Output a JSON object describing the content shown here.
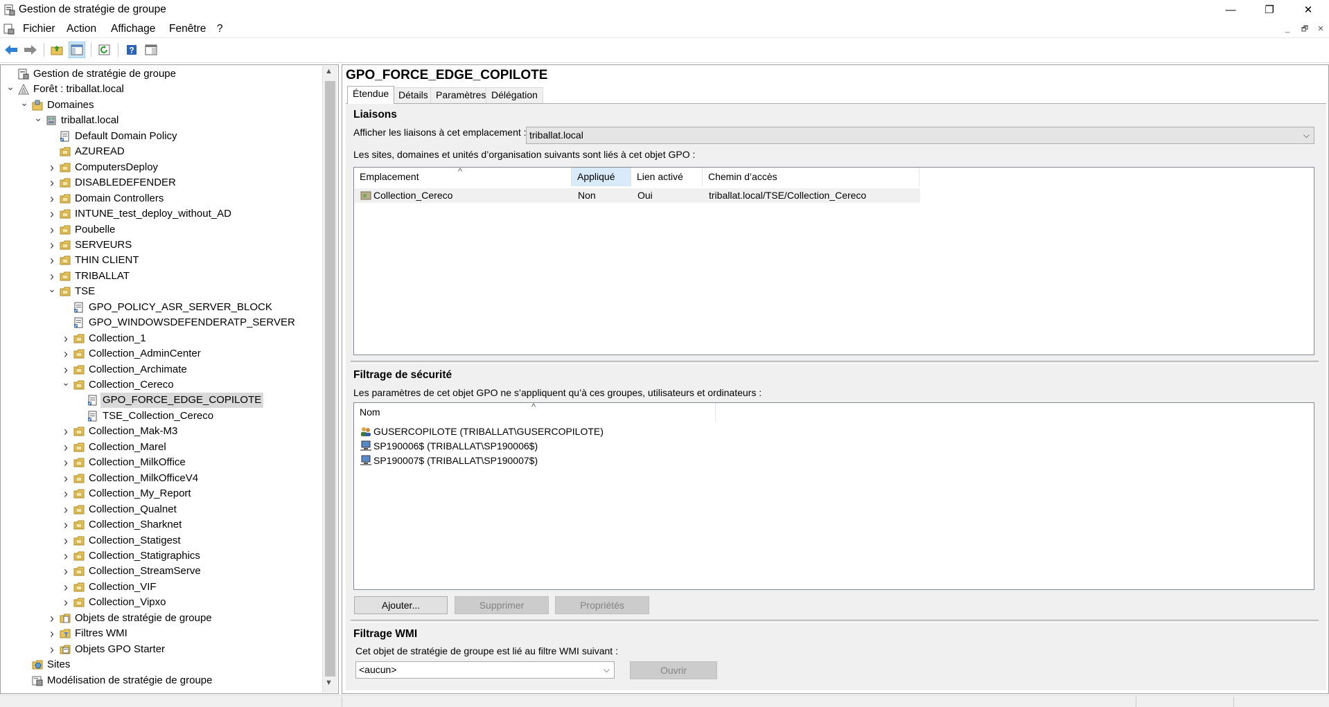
{
  "window": {
    "title": "Gestion de stratégie de groupe",
    "controls": {
      "minimize": "—",
      "restore": "❐",
      "close": "✕"
    }
  },
  "menu": [
    "Fichier",
    "Action",
    "Affichage",
    "Fenêtre",
    "?"
  ],
  "toolbar_icons": [
    "back-arrow-icon",
    "forward-arrow-icon",
    "up-folder-icon",
    "show-hide-tree-icon",
    "refresh-icon",
    "help-icon",
    "console-pane-icon"
  ],
  "tree": {
    "items": [
      {
        "label": "Gestion de stratégie de groupe",
        "icon": "gpmc-root-icon",
        "level": 0,
        "expander": ""
      },
      {
        "label": "Forêt : triballat.local",
        "icon": "forest-icon",
        "level": 0,
        "expander": "v"
      },
      {
        "label": "Domaines",
        "icon": "domains-folder-icon",
        "level": 1,
        "expander": "v"
      },
      {
        "label": "triballat.local",
        "icon": "domain-icon",
        "level": 2,
        "expander": "v"
      },
      {
        "label": "Default Domain Policy",
        "icon": "gpo-link-icon",
        "level": 3,
        "expander": ""
      },
      {
        "label": "AZUREAD",
        "icon": "ou-folder-icon",
        "level": 3,
        "expander": ""
      },
      {
        "label": "ComputersDeploy",
        "icon": "ou-folder-icon",
        "level": 3,
        "expander": ">"
      },
      {
        "label": "DISABLEDEFENDER",
        "icon": "ou-folder-icon",
        "level": 3,
        "expander": ">"
      },
      {
        "label": "Domain Controllers",
        "icon": "ou-folder-icon",
        "level": 3,
        "expander": ">"
      },
      {
        "label": "INTUNE_test_deploy_without_AD",
        "icon": "ou-folder-icon",
        "level": 3,
        "expander": ">"
      },
      {
        "label": "Poubelle",
        "icon": "ou-folder-icon",
        "level": 3,
        "expander": ">"
      },
      {
        "label": "SERVEURS",
        "icon": "ou-folder-icon",
        "level": 3,
        "expander": ">"
      },
      {
        "label": "THIN CLIENT",
        "icon": "ou-folder-icon",
        "level": 3,
        "expander": ">"
      },
      {
        "label": "TRIBALLAT",
        "icon": "ou-folder-icon",
        "level": 3,
        "expander": ">"
      },
      {
        "label": "TSE",
        "icon": "ou-folder-icon",
        "level": 3,
        "expander": "v"
      },
      {
        "label": "GPO_POLICY_ASR_SERVER_BLOCK",
        "icon": "gpo-link-icon",
        "level": 4,
        "expander": ""
      },
      {
        "label": "GPO_WINDOWSDEFENDERATP_SERVER",
        "icon": "gpo-link-icon",
        "level": 4,
        "expander": ""
      },
      {
        "label": "Collection_1",
        "icon": "ou-folder-icon",
        "level": 4,
        "expander": ">"
      },
      {
        "label": "Collection_AdminCenter",
        "icon": "ou-folder-icon",
        "level": 4,
        "expander": ">"
      },
      {
        "label": "Collection_Archimate",
        "icon": "ou-folder-icon",
        "level": 4,
        "expander": ">"
      },
      {
        "label": "Collection_Cereco",
        "icon": "ou-folder-icon",
        "level": 4,
        "expander": "v"
      },
      {
        "label": "GPO_FORCE_EDGE_COPILOTE",
        "icon": "gpo-link-icon",
        "level": 5,
        "expander": "",
        "selected": true
      },
      {
        "label": "TSE_Collection_Cereco",
        "icon": "gpo-link-icon",
        "level": 5,
        "expander": ""
      },
      {
        "label": "Collection_Mak-M3",
        "icon": "ou-folder-icon",
        "level": 4,
        "expander": ">"
      },
      {
        "label": "Collection_Marel",
        "icon": "ou-folder-icon",
        "level": 4,
        "expander": ">"
      },
      {
        "label": "Collection_MilkOffice",
        "icon": "ou-folder-icon",
        "level": 4,
        "expander": ">"
      },
      {
        "label": "Collection_MilkOfficeV4",
        "icon": "ou-folder-icon",
        "level": 4,
        "expander": ">"
      },
      {
        "label": "Collection_My_Report",
        "icon": "ou-folder-icon",
        "level": 4,
        "expander": ">"
      },
      {
        "label": "Collection_Qualnet",
        "icon": "ou-folder-icon",
        "level": 4,
        "expander": ">"
      },
      {
        "label": "Collection_Sharknet",
        "icon": "ou-folder-icon",
        "level": 4,
        "expander": ">"
      },
      {
        "label": "Collection_Statigest",
        "icon": "ou-folder-icon",
        "level": 4,
        "expander": ">"
      },
      {
        "label": "Collection_Statigraphics",
        "icon": "ou-folder-icon",
        "level": 4,
        "expander": ">"
      },
      {
        "label": "Collection_StreamServe",
        "icon": "ou-folder-icon",
        "level": 4,
        "expander": ">"
      },
      {
        "label": "Collection_VIF",
        "icon": "ou-folder-icon",
        "level": 4,
        "expander": ">"
      },
      {
        "label": "Collection_Vipxo",
        "icon": "ou-folder-icon",
        "level": 4,
        "expander": ">"
      },
      {
        "label": "Objets de stratégie de groupe",
        "icon": "gpo-container-icon",
        "level": 3,
        "expander": ">"
      },
      {
        "label": "Filtres WMI",
        "icon": "wmi-folder-icon",
        "level": 3,
        "expander": ">"
      },
      {
        "label": "Objets GPO Starter",
        "icon": "starter-gpo-icon",
        "level": 3,
        "expander": ">"
      },
      {
        "label": "Sites",
        "icon": "sites-icon",
        "level": 1,
        "expander": ""
      },
      {
        "label": "Modélisation de stratégie de groupe",
        "icon": "modeling-icon",
        "level": 1,
        "expander": ""
      }
    ]
  },
  "gpo": {
    "title": "GPO_FORCE_EDGE_COPILOTE",
    "tabs": [
      {
        "label": "Étendue",
        "active": true
      },
      {
        "label": "Détails"
      },
      {
        "label": "Paramètres"
      },
      {
        "label": "Délégation"
      }
    ]
  },
  "links": {
    "section_title": "Liaisons",
    "location_label": "Afficher les liaisons à cet emplacement :",
    "location_value": "triballat.local",
    "description": "Les sites, domaines et unités d’organisation suivants sont liés à cet objet GPO :",
    "columns": [
      "Emplacement",
      "Appliqué",
      "Lien activé",
      "Chemin d’accès"
    ],
    "rows": [
      {
        "location": "Collection_Cereco",
        "enforced": "Non",
        "enabled": "Oui",
        "path": "triballat.local/TSE/Collection_Cereco"
      }
    ]
  },
  "security": {
    "section_title": "Filtrage de sécurité",
    "description": "Les paramètres de cet objet GPO ne s’appliquent qu’à ces groupes, utilisateurs et ordinateurs :",
    "column": "Nom",
    "rows": [
      {
        "name": "GUSERCOPILOTE (TRIBALLAT\\GUSERCOPILOTE)",
        "icon": "group-icon"
      },
      {
        "name": "SP190006$ (TRIBALLAT\\SP190006$)",
        "icon": "computer-icon"
      },
      {
        "name": "SP190007$ (TRIBALLAT\\SP190007$)",
        "icon": "computer-icon"
      }
    ],
    "buttons": {
      "add": "Ajouter...",
      "remove": "Supprimer",
      "properties": "Propriétés"
    }
  },
  "wmi": {
    "section_title": "Filtrage WMI",
    "description": "Cet objet de stratégie de groupe est lié au filtre WMI suivant :",
    "value": "<aucun>",
    "open_button": "Ouvrir"
  },
  "colors": {
    "selected_row": "#d9d9d9",
    "sorted_column": "#d9ebf9",
    "pane_background": "#f0f0f0",
    "folder": "#e8c45a"
  }
}
